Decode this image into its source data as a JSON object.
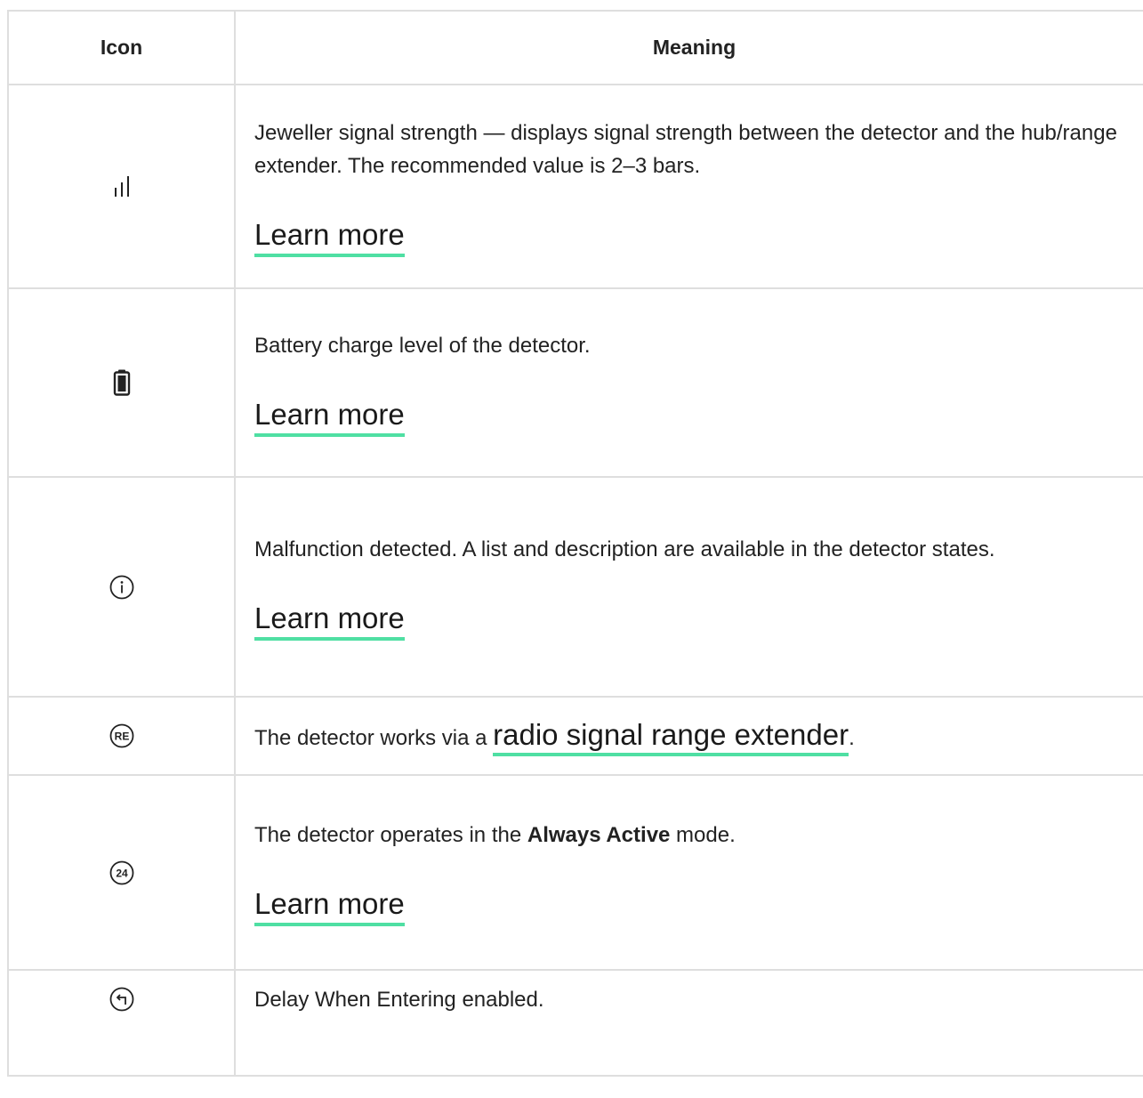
{
  "table": {
    "headers": {
      "icon": "Icon",
      "meaning": "Meaning"
    },
    "rows": [
      {
        "icon": "signal-strength-icon",
        "text": "Jeweller signal strength — displays signal strength between the detector and the hub/range extender. The recommended value is 2–3 bars.",
        "link": "Learn more"
      },
      {
        "icon": "battery-icon",
        "text": "Battery charge level of the detector.",
        "link": "Learn more"
      },
      {
        "icon": "info-circle-icon",
        "text": "Malfunction detected. A list and description are available in the detector states.",
        "link": "Learn more"
      },
      {
        "icon": "range-extender-icon",
        "icon_text": "RE",
        "text_before": "The detector works via a ",
        "link": "radio signal range extender",
        "text_after": "."
      },
      {
        "icon": "always-active-24-icon",
        "icon_text": "24",
        "text_before": "The detector operates in the ",
        "text_bold": "Always Active",
        "text_after": " mode.",
        "link": "Learn more"
      },
      {
        "icon": "delay-entering-icon",
        "text": "Delay When Entering enabled."
      }
    ]
  },
  "colors": {
    "border": "#dedede",
    "link_underline": "#4fdfa3",
    "text": "#222222"
  }
}
